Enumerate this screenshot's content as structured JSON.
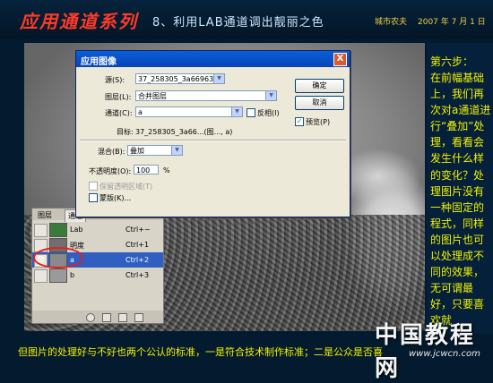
{
  "header": {
    "series_title": "应用通道系列",
    "lesson_title": "8、利用LAB通道调出靓丽之色",
    "author": "城市农夫",
    "date": "2007 年 7 月 1 日"
  },
  "sidebar": {
    "step_title": "第六步：",
    "text": "在前幅基础上，我们再次对a通道进行“叠加”处理，看看会发生什么样的变化？处理图片没有一种固定的程式，同样的图片也可以处理成不同的效果，无可谓最好，只要喜欢就"
  },
  "footer": {
    "text": "但图片的处理好与不好也两个公认的标准，一是符合技术制作标准；二是公众是否喜"
  },
  "watermark": {
    "text": "中国教程网",
    "url": "www.jcwcn.com"
  },
  "dialog": {
    "title": "应用图像",
    "source_label": "源(S):",
    "source_value": "37_258305_3a6696394...",
    "layer_label": "图层(L):",
    "layer_value": "合并图层",
    "channel_label": "通道(C):",
    "channel_value": "a",
    "invert_label": "反相(I)",
    "target_label": "目标:",
    "target_value": "37_258305_3a66...(图..., a)",
    "blending_label": "混合(B):",
    "blending_value": "叠加",
    "opacity_label": "不透明度(O):",
    "opacity_value": "100",
    "opacity_unit": "%",
    "preserve_label": "保留透明区域(T)",
    "mask_label": "蒙版(K)...",
    "ok_label": "确定",
    "cancel_label": "取消",
    "preview_label": "预览(P)",
    "preview_checked": true,
    "close_glyph": "X"
  },
  "layers_panel": {
    "tabs": [
      "图层",
      "通道"
    ],
    "rows": [
      {
        "name": "Lab",
        "shortcut": "Ctrl+~",
        "thumb_color": "#3a7a3a"
      },
      {
        "name": "明度",
        "shortcut": "Ctrl+1",
        "thumb_color": "#6f6f6f"
      },
      {
        "name": "a",
        "shortcut": "Ctrl+2",
        "thumb_color": "#8a8a8a",
        "selected": true
      },
      {
        "name": "b",
        "shortcut": "Ctrl+3",
        "thumb_color": "#9a9a9a"
      }
    ]
  }
}
